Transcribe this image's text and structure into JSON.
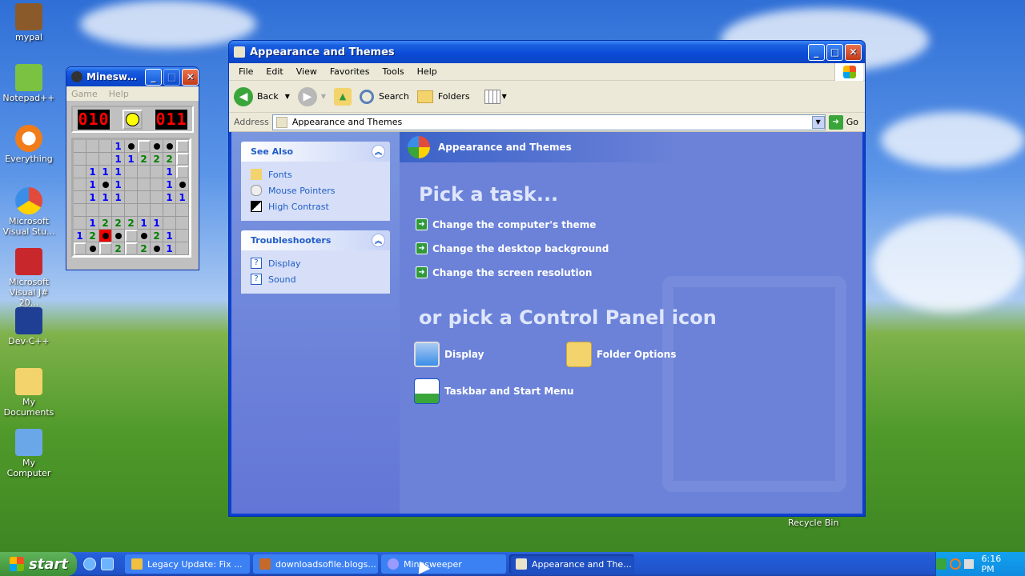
{
  "desktop": {
    "icons": [
      {
        "label": "mypal",
        "color": "#8b5a2b"
      },
      {
        "label": "Notepad++",
        "color": "#7cc242"
      },
      {
        "label": "Everything",
        "color": "#f07d1a"
      },
      {
        "label": "Microsoft Visual Stu...",
        "color": "#e24a3c"
      },
      {
        "label": "Microsoft Visual J# 20...",
        "color": "#c8282c"
      },
      {
        "label": "Dev-C++",
        "color": "#1f3f94"
      },
      {
        "label": "My Documents",
        "color": "#f3d36b"
      },
      {
        "label": "My Computer",
        "color": "#6aa7e8"
      }
    ],
    "recycle_bin": "Recycle Bin"
  },
  "explorer": {
    "title": "Appearance and Themes",
    "menu": [
      "File",
      "Edit",
      "View",
      "Favorites",
      "Tools",
      "Help"
    ],
    "toolbar": {
      "back": "Back",
      "search": "Search",
      "folders": "Folders"
    },
    "address": {
      "label": "Address",
      "value": "Appearance and Themes",
      "go": "Go"
    },
    "see_also": {
      "title": "See Also",
      "items": [
        "Fonts",
        "Mouse Pointers",
        "High Contrast"
      ]
    },
    "troubleshooters": {
      "title": "Troubleshooters",
      "items": [
        "Display",
        "Sound"
      ]
    },
    "main": {
      "header": "Appearance and Themes",
      "pick_task": "Pick a task...",
      "tasks": [
        "Change the computer's theme",
        "Change the desktop background",
        "Change the screen resolution"
      ],
      "pick_icon": "or pick a Control Panel icon",
      "icons": [
        "Display",
        "Folder Options",
        "Taskbar and Start Menu"
      ]
    }
  },
  "minesweeper": {
    "title": "Minesweeper",
    "title_short": "Minesweeper",
    "menu": [
      "Game",
      "Help"
    ],
    "mines_left": "010",
    "timer": "011",
    "grid": [
      [
        "",
        "",
        "",
        "1",
        "m",
        "c",
        "m",
        "m",
        "c"
      ],
      [
        "",
        "",
        "",
        "1",
        "1",
        "2",
        "2",
        "2",
        "c"
      ],
      [
        "",
        "1",
        "1",
        "1",
        "",
        "",
        "",
        "1",
        "c"
      ],
      [
        "",
        "1",
        "m",
        "1",
        "",
        "",
        "",
        "1",
        "m"
      ],
      [
        "",
        "1",
        "1",
        "1",
        "",
        "",
        "",
        "1",
        "1"
      ],
      [
        "",
        "",
        "",
        "",
        "",
        "",
        "",
        "",
        ""
      ],
      [
        "",
        "1",
        "2",
        "2",
        "2",
        "1",
        "1",
        "",
        ""
      ],
      [
        "1",
        "2",
        "x",
        "m",
        "c",
        "m",
        "2",
        "1",
        ""
      ],
      [
        "c",
        "m",
        "c",
        "2",
        "c",
        "2",
        "m",
        "1",
        ""
      ]
    ]
  },
  "taskbar": {
    "start": "start",
    "tasks": [
      {
        "label": "Legacy Update: Fix ...",
        "color": "#f0c040"
      },
      {
        "label": "downloadsofile.blogs...",
        "color": "#c46a2a"
      },
      {
        "label": "Minesweeper",
        "color": "#9a9aff"
      },
      {
        "label": "Appearance and The...",
        "color": "#e9e4c9"
      }
    ],
    "clock": "6:16 PM"
  }
}
